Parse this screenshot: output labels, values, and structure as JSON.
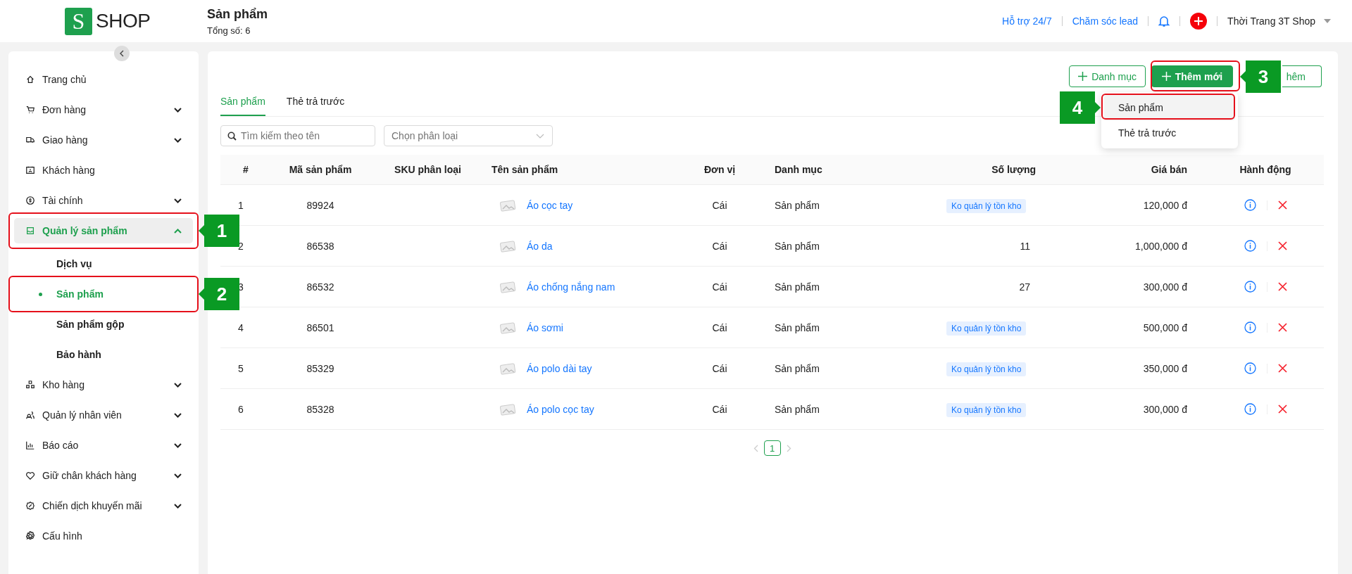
{
  "logo": {
    "mark": "S",
    "text": "SHOP"
  },
  "page": {
    "title": "Sản phẩm",
    "subtitle": "Tổng số: 6"
  },
  "header_links": [
    "Hỗ trợ 24/7",
    "Chăm sóc lead"
  ],
  "account": {
    "name": "Thời Trang 3T Shop"
  },
  "sidebar": {
    "items": [
      {
        "label": "Trang chủ",
        "selected": false
      },
      {
        "label": "Đơn hàng",
        "expanded": false,
        "selected": false
      },
      {
        "label": "Giao hàng",
        "expanded": false,
        "selected": false
      },
      {
        "label": "Khách hàng",
        "selected": false
      },
      {
        "label": "Tài chính",
        "expanded": false,
        "selected": false
      },
      {
        "label": "Quản lý sản phẩm",
        "expanded": true,
        "selected": true,
        "children": [
          {
            "label": "Dịch vụ",
            "selected": false
          },
          {
            "label": "Sản phẩm",
            "selected": true
          },
          {
            "label": "Sản phẩm gộp",
            "selected": false
          },
          {
            "label": "Bảo hành",
            "selected": false
          }
        ]
      },
      {
        "label": "Kho hàng",
        "expanded": false,
        "selected": false
      },
      {
        "label": "Quản lý nhân viên",
        "expanded": false,
        "selected": false
      },
      {
        "label": "Báo cáo",
        "expanded": false,
        "selected": false
      },
      {
        "label": "Giữ chân khách hàng",
        "expanded": false,
        "selected": false
      },
      {
        "label": "Chiến dịch khuyến mãi",
        "expanded": false,
        "selected": false
      },
      {
        "label": "Cấu hình",
        "selected": false
      }
    ]
  },
  "toolbar": {
    "buttons": [
      {
        "label": "Danh mục",
        "kind": "outline"
      },
      {
        "label": "Thêm mới",
        "kind": "primary"
      },
      {
        "label": "hêm",
        "kind": "dropdown"
      }
    ]
  },
  "add_menu": {
    "items": [
      {
        "label": "Sản phẩm",
        "selected": true
      },
      {
        "label": "Thẻ trả trước",
        "selected": false
      }
    ]
  },
  "tabs": [
    {
      "label": "Sản phẩm",
      "selected": true
    },
    {
      "label": "Thẻ trả trước",
      "selected": false
    }
  ],
  "search": {
    "placeholder": "Tìm kiếm theo tên"
  },
  "category_select": {
    "placeholder": "Chọn phân loại"
  },
  "table": {
    "columns": [
      "#",
      "Mã sản phẩm",
      "SKU phân loại",
      "Tên sản phẩm",
      "Đơn vị",
      "Danh mục",
      "Số lượng",
      "Giá bán",
      "Hành động"
    ],
    "rows": [
      {
        "index": "1",
        "code": "89924",
        "name": "Áo cọc tay",
        "unit": "Cái",
        "category": "Sản phẩm",
        "stock_tag": "Ko quản lý tồn kho",
        "price": "120,000 đ"
      },
      {
        "index": "2",
        "code": "86538",
        "name": "Áo da",
        "unit": "Cái",
        "category": "Sản phẩm",
        "quantity": "11",
        "price": "1,000,000 đ"
      },
      {
        "index": "3",
        "code": "86532",
        "name": "Áo chống nắng nam",
        "unit": "Cái",
        "category": "Sản phẩm",
        "quantity": "27",
        "price": "300,000 đ"
      },
      {
        "index": "4",
        "code": "86501",
        "name": "Áo sơmi",
        "unit": "Cái",
        "category": "Sản phẩm",
        "stock_tag": "Ko quản lý tồn kho",
        "price": "500,000 đ"
      },
      {
        "index": "5",
        "code": "85329",
        "name": "Áo polo dài tay",
        "unit": "Cái",
        "category": "Sản phẩm",
        "stock_tag": "Ko quản lý tồn kho",
        "price": "350,000 đ"
      },
      {
        "index": "6",
        "code": "85328",
        "name": "Áo polo cọc tay",
        "unit": "Cái",
        "category": "Sản phẩm",
        "stock_tag": "Ko quản lý tồn kho",
        "price": "300,000 đ"
      }
    ]
  },
  "pagination": {
    "pages": [
      {
        "label": "1",
        "selected": true
      }
    ]
  },
  "callouts": [
    "1",
    "2",
    "3",
    "4"
  ]
}
